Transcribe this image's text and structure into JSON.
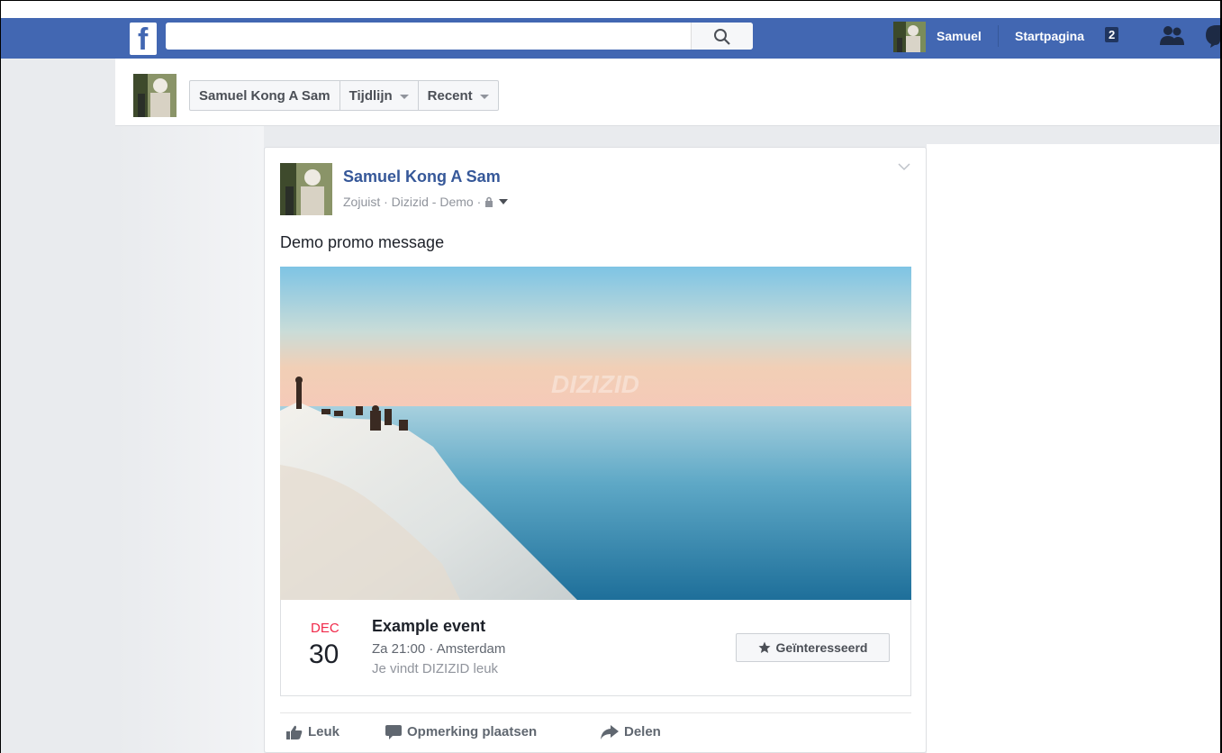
{
  "topbar": {
    "logo_letter": "f",
    "search_placeholder": "",
    "user_name": "Samuel",
    "home_label": "Startpagina",
    "home_count": "2"
  },
  "subheader": {
    "nav": [
      "Samuel Kong A Sam",
      "Tijdlijn",
      "Recent"
    ]
  },
  "post": {
    "author": "Samuel Kong A Sam",
    "meta": "Zojuist · Dizizid - Demo ·",
    "text": "Demo promo message",
    "image_watermark": "DIZIZID",
    "event": {
      "month": "DEC",
      "day": "30",
      "title": "Example event",
      "details": "Za 21:00 · Amsterdam",
      "social": "Je vindt DIZIZID leuk",
      "interested_label": "Geïnteresseerd"
    },
    "actions": {
      "like": "Leuk",
      "comment": "Opmerking plaatsen",
      "share": "Delen"
    }
  },
  "colors": {
    "brand": "#4267b2",
    "link": "#365899",
    "event_month": "#f02849"
  }
}
